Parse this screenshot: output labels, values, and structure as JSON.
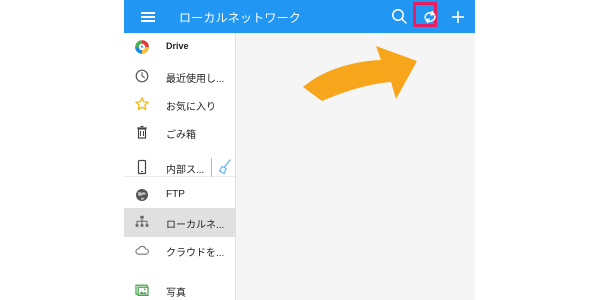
{
  "header": {
    "title": "ローカルネットワーク",
    "icons": {
      "menu": "hamburger-menu-icon",
      "search": "search-icon",
      "refresh": "refresh-icon",
      "add": "plus-icon"
    }
  },
  "sidebar": {
    "items": [
      {
        "label": "Drive",
        "icon": "drive-icon"
      },
      {
        "label": "最近使用し...",
        "icon": "recent-icon"
      },
      {
        "label": "お気に入り",
        "icon": "favorite-star-icon"
      },
      {
        "label": "ごみ箱",
        "icon": "trash-icon"
      },
      {
        "label": "内部ス...",
        "icon": "phone-icon"
      },
      {
        "label": "FTP",
        "icon": "ftp-globe-icon"
      },
      {
        "label": "ローカルネ...",
        "icon": "local-network-icon",
        "active": true
      },
      {
        "label": "クラウドを...",
        "icon": "cloud-icon"
      },
      {
        "label": "写真",
        "icon": "photo-icon"
      }
    ],
    "extra_icon": "cleanup-brush-icon"
  },
  "colors": {
    "accent": "#2196f3",
    "highlight": "#e91e63",
    "arrow": "#f7a51a"
  }
}
